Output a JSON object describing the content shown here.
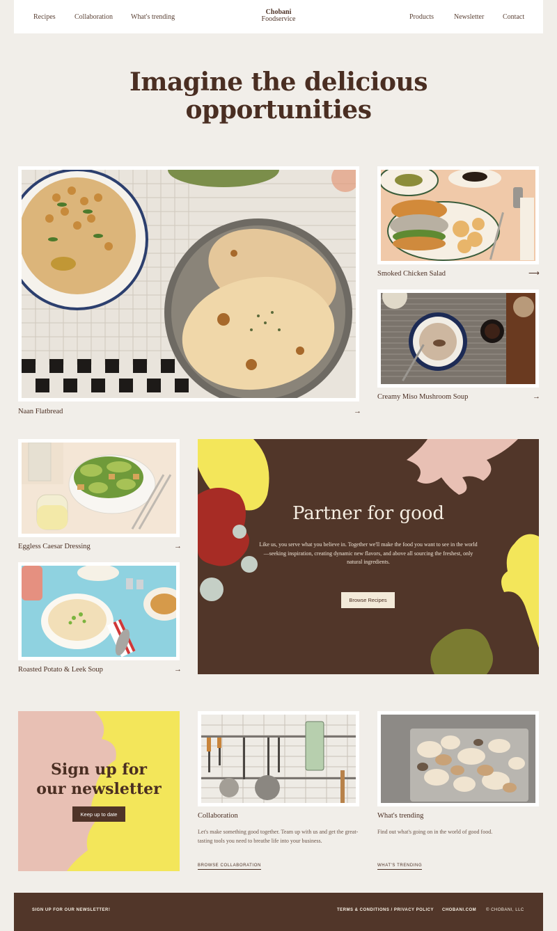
{
  "header": {
    "nav_left": [
      "Recipes",
      "Collaboration",
      "What's trending"
    ],
    "logo_line1": "Chobani",
    "logo_line2": "Foodservice",
    "nav_right": [
      "Products",
      "Newsletter",
      "Contact"
    ]
  },
  "hero": {
    "title": "Imagine the delicious opportunities"
  },
  "recipes": [
    {
      "label": "Naan Flatbread",
      "arrow": "→"
    },
    {
      "label": "Smoked Chicken Salad",
      "arrow": "⟶"
    },
    {
      "label": "Creamy Miso Mushroom Soup",
      "arrow": "→"
    },
    {
      "label": "Eggless Caesar Dressing",
      "arrow": "→"
    },
    {
      "label": "Roasted Potato & Leek Soup",
      "arrow": "→"
    }
  ],
  "promo": {
    "title": "Partner for good",
    "text": "Like us, you serve what you believe in. Together we'll make the food you want to see in the world—seeking inspiration, creating dynamic new flavors, and above all sourcing the freshest, only natural ingredients.",
    "button": "Browse Recipes"
  },
  "newsletter": {
    "title_line1": "Sign up for",
    "title_line2": "our newsletter",
    "button": "Keep up to date"
  },
  "collaboration": {
    "title": "Collaboration",
    "text": "Let's make something good together. Team up with us and get the great-tasting tools you need to breathe life into your business.",
    "link": "BROWSE COLLABORATION"
  },
  "trending": {
    "title": "What's trending",
    "text": "Find out what's going on in the world of good food.",
    "link": "WHAT'S TRENDING"
  },
  "footer": {
    "signup": "SIGN UP FOR OUR NEWSLETTER!",
    "terms": "TERMS & CONDITIONS / PRIVACY POLICY",
    "site": "CHOBANI.COM",
    "copyright": "© CHOBANI, LLC"
  },
  "colors": {
    "brown": "#513629",
    "cream": "#f1eee9",
    "yellow": "#f3e65a",
    "pink": "#e8c0b4"
  }
}
